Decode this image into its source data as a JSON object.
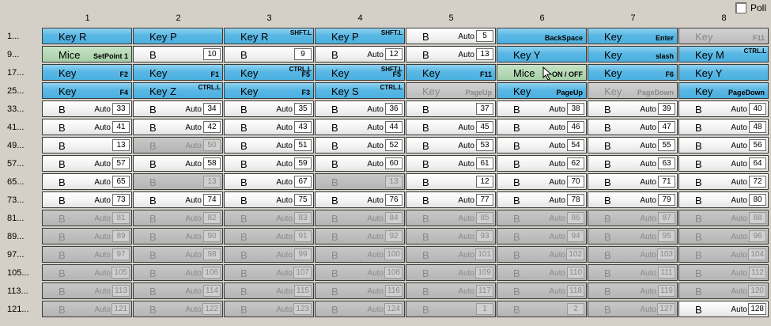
{
  "poll": {
    "label": "Poll"
  },
  "columns": [
    "1",
    "2",
    "3",
    "4",
    "5",
    "6",
    "7",
    "8"
  ],
  "rows": [
    {
      "label": "1...",
      "cells": [
        {
          "k": "key",
          "main": "Key R"
        },
        {
          "k": "key",
          "main": "Key P"
        },
        {
          "k": "key",
          "main": "Key R",
          "sup": "SHFT.L"
        },
        {
          "k": "key",
          "main": "Key P",
          "sup": "SHFT.L"
        },
        {
          "k": "white",
          "main": "B",
          "mode": "Auto",
          "num": "5"
        },
        {
          "k": "key",
          "main": "",
          "sub": "BackSpace"
        },
        {
          "k": "key",
          "main": "Key",
          "sub": "Enter"
        },
        {
          "k": "dkey",
          "main": "Key",
          "sub": "F11"
        }
      ]
    },
    {
      "label": "9...",
      "cells": [
        {
          "k": "green",
          "main": "Mice",
          "sub": "SetPoint 1"
        },
        {
          "k": "white",
          "main": "B",
          "num": "10"
        },
        {
          "k": "white",
          "main": "B",
          "num": "9"
        },
        {
          "k": "white",
          "main": "B",
          "mode": "Auto",
          "num": "12"
        },
        {
          "k": "white",
          "main": "B",
          "mode": "Auto",
          "num": "13"
        },
        {
          "k": "key",
          "main": "Key Y"
        },
        {
          "k": "key",
          "main": "Key",
          "sub": "slash"
        },
        {
          "k": "key",
          "main": "Key M",
          "sup": "CTRL.L"
        }
      ]
    },
    {
      "label": "17...",
      "cells": [
        {
          "k": "key",
          "main": "Key",
          "sub": "F2"
        },
        {
          "k": "key",
          "main": "Key",
          "sub": "F1"
        },
        {
          "k": "key",
          "main": "Key",
          "sub": "F5",
          "sup": "CTRL.L"
        },
        {
          "k": "key",
          "main": "Key",
          "sub": "F5",
          "sup": "SHFT.L"
        },
        {
          "k": "key",
          "main": "Key",
          "sub": "F11"
        },
        {
          "k": "green",
          "main": "Mice",
          "sub": "ON / OFF",
          "cursor": true
        },
        {
          "k": "key",
          "main": "Key",
          "sub": "F6"
        },
        {
          "k": "key",
          "main": "Key Y"
        }
      ]
    },
    {
      "label": "25...",
      "cells": [
        {
          "k": "key",
          "main": "Key",
          "sub": "F4"
        },
        {
          "k": "key",
          "main": "Key Z",
          "sup": "CTRL.L"
        },
        {
          "k": "key",
          "main": "Key",
          "sub": "F3"
        },
        {
          "k": "key",
          "main": "Key S",
          "sup": "CTRL.L"
        },
        {
          "k": "dkey",
          "main": "Key",
          "sub": "PageUp"
        },
        {
          "k": "key",
          "main": "Key",
          "sub": "PageUp"
        },
        {
          "k": "dkey",
          "main": "Key",
          "sub": "PageDown"
        },
        {
          "k": "key",
          "main": "Key",
          "sub": "PageDown"
        }
      ]
    },
    {
      "label": "33...",
      "cells": [
        {
          "k": "white",
          "main": "B",
          "mode": "Auto",
          "num": "33"
        },
        {
          "k": "white",
          "main": "B",
          "mode": "Auto",
          "num": "34"
        },
        {
          "k": "white",
          "main": "B",
          "mode": "Auto",
          "num": "35"
        },
        {
          "k": "white",
          "main": "B",
          "mode": "Auto",
          "num": "36"
        },
        {
          "k": "white",
          "main": "B",
          "num": "37"
        },
        {
          "k": "white",
          "main": "B",
          "mode": "Auto",
          "num": "38"
        },
        {
          "k": "white",
          "main": "B",
          "mode": "Auto",
          "num": "39"
        },
        {
          "k": "white",
          "main": "B",
          "mode": "Auto",
          "num": "40"
        }
      ]
    },
    {
      "label": "41...",
      "cells": [
        {
          "k": "white",
          "main": "B",
          "mode": "Auto",
          "num": "41"
        },
        {
          "k": "white",
          "main": "B",
          "mode": "Auto",
          "num": "42"
        },
        {
          "k": "white",
          "main": "B",
          "mode": "Auto",
          "num": "43"
        },
        {
          "k": "white",
          "main": "B",
          "mode": "Auto",
          "num": "44"
        },
        {
          "k": "white",
          "main": "B",
          "mode": "Auto",
          "num": "45"
        },
        {
          "k": "white",
          "main": "B",
          "mode": "Auto",
          "num": "46"
        },
        {
          "k": "white",
          "main": "B",
          "mode": "Auto",
          "num": "47"
        },
        {
          "k": "white",
          "main": "B",
          "mode": "Auto",
          "num": "48"
        }
      ]
    },
    {
      "label": "49...",
      "cells": [
        {
          "k": "white",
          "main": "B",
          "num": "13"
        },
        {
          "k": "disabled",
          "main": "B",
          "mode": "Auto",
          "num": "50"
        },
        {
          "k": "white",
          "main": "B",
          "mode": "Auto",
          "num": "51"
        },
        {
          "k": "white",
          "main": "B",
          "mode": "Auto",
          "num": "52"
        },
        {
          "k": "white",
          "main": "B",
          "mode": "Auto",
          "num": "53"
        },
        {
          "k": "white",
          "main": "B",
          "mode": "Auto",
          "num": "54"
        },
        {
          "k": "white",
          "main": "B",
          "mode": "Auto",
          "num": "55"
        },
        {
          "k": "white",
          "main": "B",
          "mode": "Auto",
          "num": "56"
        }
      ]
    },
    {
      "label": "57...",
      "cells": [
        {
          "k": "white",
          "main": "B",
          "mode": "Auto",
          "num": "57"
        },
        {
          "k": "white",
          "main": "B",
          "mode": "Auto",
          "num": "58"
        },
        {
          "k": "white",
          "main": "B",
          "mode": "Auto",
          "num": "59"
        },
        {
          "k": "white",
          "main": "B",
          "mode": "Auto",
          "num": "60"
        },
        {
          "k": "white",
          "main": "B",
          "mode": "Auto",
          "num": "61"
        },
        {
          "k": "white",
          "main": "B",
          "mode": "Auto",
          "num": "62"
        },
        {
          "k": "white",
          "main": "B",
          "mode": "Auto",
          "num": "63"
        },
        {
          "k": "white",
          "main": "B",
          "mode": "Auto",
          "num": "64"
        }
      ]
    },
    {
      "label": "65...",
      "cells": [
        {
          "k": "white",
          "main": "B",
          "mode": "Auto",
          "num": "65"
        },
        {
          "k": "disabled",
          "main": "B",
          "num": "13"
        },
        {
          "k": "white",
          "main": "B",
          "mode": "Auto",
          "num": "67"
        },
        {
          "k": "disabled",
          "main": "B",
          "num": "13"
        },
        {
          "k": "white",
          "main": "B",
          "num": "12"
        },
        {
          "k": "white",
          "main": "B",
          "mode": "Auto",
          "num": "70"
        },
        {
          "k": "white",
          "main": "B",
          "mode": "Auto",
          "num": "71"
        },
        {
          "k": "white",
          "main": "B",
          "mode": "Auto",
          "num": "72"
        }
      ]
    },
    {
      "label": "73...",
      "cells": [
        {
          "k": "white",
          "main": "B",
          "mode": "Auto",
          "num": "73"
        },
        {
          "k": "white",
          "main": "B",
          "mode": "Auto",
          "num": "74"
        },
        {
          "k": "white",
          "main": "B",
          "mode": "Auto",
          "num": "75"
        },
        {
          "k": "white",
          "main": "B",
          "mode": "Auto",
          "num": "76"
        },
        {
          "k": "white",
          "main": "B",
          "mode": "Auto",
          "num": "77"
        },
        {
          "k": "white",
          "main": "B",
          "mode": "Auto",
          "num": "78"
        },
        {
          "k": "white",
          "main": "B",
          "mode": "Auto",
          "num": "79"
        },
        {
          "k": "white",
          "main": "B",
          "mode": "Auto",
          "num": "80"
        }
      ]
    },
    {
      "label": "81...",
      "cells": [
        {
          "k": "disabled",
          "main": "B",
          "mode": "Auto",
          "num": "81"
        },
        {
          "k": "disabled",
          "main": "B",
          "mode": "Auto",
          "num": "82"
        },
        {
          "k": "disabled",
          "main": "B",
          "mode": "Auto",
          "num": "83"
        },
        {
          "k": "disabled",
          "main": "B",
          "mode": "Auto",
          "num": "84"
        },
        {
          "k": "disabled",
          "main": "B",
          "mode": "Auto",
          "num": "85"
        },
        {
          "k": "disabled",
          "main": "B",
          "mode": "Auto",
          "num": "86"
        },
        {
          "k": "disabled",
          "main": "B",
          "mode": "Auto",
          "num": "87"
        },
        {
          "k": "disabled",
          "main": "B",
          "mode": "Auto",
          "num": "88"
        }
      ]
    },
    {
      "label": "89...",
      "cells": [
        {
          "k": "disabled",
          "main": "B",
          "mode": "Auto",
          "num": "89"
        },
        {
          "k": "disabled",
          "main": "B",
          "mode": "Auto",
          "num": "90"
        },
        {
          "k": "disabled",
          "main": "B",
          "mode": "Auto",
          "num": "91"
        },
        {
          "k": "disabled",
          "main": "B",
          "mode": "Auto",
          "num": "92"
        },
        {
          "k": "disabled",
          "main": "B",
          "mode": "Auto",
          "num": "93"
        },
        {
          "k": "disabled",
          "main": "B",
          "mode": "Auto",
          "num": "94"
        },
        {
          "k": "disabled",
          "main": "B",
          "mode": "Auto",
          "num": "95"
        },
        {
          "k": "disabled",
          "main": "B",
          "mode": "Auto",
          "num": "96"
        }
      ]
    },
    {
      "label": "97...",
      "cells": [
        {
          "k": "disabled",
          "main": "B",
          "mode": "Auto",
          "num": "97"
        },
        {
          "k": "disabled",
          "main": "B",
          "mode": "Auto",
          "num": "98"
        },
        {
          "k": "disabled",
          "main": "B",
          "mode": "Auto",
          "num": "99"
        },
        {
          "k": "disabled",
          "main": "B",
          "mode": "Auto",
          "num": "100"
        },
        {
          "k": "disabled",
          "main": "B",
          "mode": "Auto",
          "num": "101"
        },
        {
          "k": "disabled",
          "main": "B",
          "mode": "Auto",
          "num": "102"
        },
        {
          "k": "disabled",
          "main": "B",
          "mode": "Auto",
          "num": "103"
        },
        {
          "k": "disabled",
          "main": "B",
          "mode": "Auto",
          "num": "104"
        }
      ]
    },
    {
      "label": "105...",
      "cells": [
        {
          "k": "disabled",
          "main": "B",
          "mode": "Auto",
          "num": "105"
        },
        {
          "k": "disabled",
          "main": "B",
          "mode": "Auto",
          "num": "106"
        },
        {
          "k": "disabled",
          "main": "B",
          "mode": "Auto",
          "num": "107"
        },
        {
          "k": "disabled",
          "main": "B",
          "mode": "Auto",
          "num": "108"
        },
        {
          "k": "disabled",
          "main": "B",
          "mode": "Auto",
          "num": "109"
        },
        {
          "k": "disabled",
          "main": "B",
          "mode": "Auto",
          "num": "110"
        },
        {
          "k": "disabled",
          "main": "B",
          "mode": "Auto",
          "num": "111"
        },
        {
          "k": "disabled",
          "main": "B",
          "mode": "Auto",
          "num": "112"
        }
      ]
    },
    {
      "label": "113...",
      "cells": [
        {
          "k": "disabled",
          "main": "B",
          "mode": "Auto",
          "num": "113"
        },
        {
          "k": "disabled",
          "main": "B",
          "mode": "Auto",
          "num": "114"
        },
        {
          "k": "disabled",
          "main": "B",
          "mode": "Auto",
          "num": "115"
        },
        {
          "k": "disabled",
          "main": "B",
          "mode": "Auto",
          "num": "116"
        },
        {
          "k": "disabled",
          "main": "B",
          "mode": "Auto",
          "num": "117"
        },
        {
          "k": "disabled",
          "main": "B",
          "mode": "Auto",
          "num": "118"
        },
        {
          "k": "disabled",
          "main": "B",
          "mode": "Auto",
          "num": "119"
        },
        {
          "k": "disabled",
          "main": "B",
          "mode": "Auto",
          "num": "120"
        }
      ]
    },
    {
      "label": "121...",
      "cells": [
        {
          "k": "disabled",
          "main": "B",
          "mode": "Auto",
          "num": "121"
        },
        {
          "k": "disabled",
          "main": "B",
          "mode": "Auto",
          "num": "122"
        },
        {
          "k": "disabled",
          "main": "B",
          "mode": "Auto",
          "num": "123"
        },
        {
          "k": "disabled",
          "main": "B",
          "mode": "Auto",
          "num": "124"
        },
        {
          "k": "disabled",
          "main": "B",
          "num": "1"
        },
        {
          "k": "disabled",
          "main": "B",
          "num": "2"
        },
        {
          "k": "disabled",
          "main": "B",
          "mode": "Auto",
          "num": "127"
        },
        {
          "k": "white",
          "main": "B",
          "mode": "Auto",
          "num": "128"
        }
      ]
    }
  ]
}
